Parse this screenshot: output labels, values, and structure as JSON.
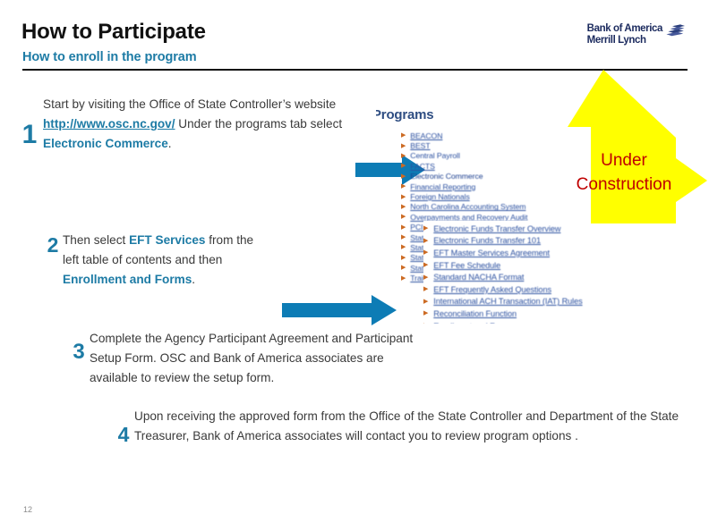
{
  "slide": {
    "title": "How to Participate",
    "subtitle": "How to enroll in the program",
    "page_number": "12"
  },
  "logo": {
    "line1": "Bank of America",
    "line2": "Merrill Lynch",
    "color": "#1b2a5e",
    "mark": "bofa-flag-icon"
  },
  "colors": {
    "accent_teal": "#1d7ba5",
    "arrow_teal": "#0d7cb5",
    "yellow": "#ffff00",
    "red": "#c00000",
    "link_blue": "#2b50a0",
    "body_gray": "#3a3a3a"
  },
  "steps": [
    {
      "number": "1",
      "text_parts": [
        {
          "t": "Start by visiting the Office of State Controller’s website ",
          "style": "plain"
        },
        {
          "t": "http://www.osc.nc.gov/",
          "style": "link"
        },
        {
          "t": " Under the  programs tab  select  ",
          "style": "plain"
        },
        {
          "t": "Electronic Commerce",
          "style": "emphasis"
        },
        {
          "t": ".",
          "style": "plain"
        }
      ]
    },
    {
      "number": "2",
      "text_parts": [
        {
          "t": "Then select ",
          "style": "plain"
        },
        {
          "t": "EFT Services",
          "style": "emphasis"
        },
        {
          "t": "  from the left table of contents and then ",
          "style": "plain"
        },
        {
          "t": "Enrollment and Forms",
          "style": "emphasis"
        },
        {
          "t": ".",
          "style": "plain"
        }
      ]
    },
    {
      "number": "3",
      "text_parts": [
        {
          "t": "Complete the Agency Participant Agreement and Participant Setup Form. OSC and Bank of America associates are available to review the setup form.",
          "style": "plain"
        }
      ]
    },
    {
      "number": "4",
      "text_parts": [
        {
          "t": "Upon receiving the approved form from the Office of the State Controller and Department of the State Treasurer, Bank of America associates will contact you to review program options .",
          "style": "plain"
        }
      ]
    }
  ],
  "screenshot": {
    "heading": "Programs",
    "programs": [
      {
        "label": "BEACON",
        "kind": "link"
      },
      {
        "label": "BEST",
        "kind": "link"
      },
      {
        "label": "Central Payroll",
        "kind": "plain"
      },
      {
        "label": "FACTS",
        "kind": "link"
      },
      {
        "label": "Electronic Commerce",
        "kind": "highlight"
      },
      {
        "label": "Financial Reporting",
        "kind": "link"
      },
      {
        "label": "Foreign Nationals",
        "kind": "link"
      },
      {
        "label": "North Carolina Accounting System",
        "kind": "link"
      },
      {
        "label": "Overpayments and Recovery Audit",
        "kind": "link"
      },
      {
        "label": "PCI Data Security",
        "kind": "link"
      },
      {
        "label": "State Cash Management Plan",
        "kind": "link"
      },
      {
        "label": "State",
        "kind": "link"
      },
      {
        "label": "State",
        "kind": "link"
      },
      {
        "label": "State",
        "kind": "link"
      },
      {
        "label": "Traini",
        "kind": "link"
      }
    ],
    "eft_submenu": [
      "Electronic Funds Transfer Overview",
      "Electronic Funds Transfer 101",
      "EFT Master Services Agreement",
      "EFT Fee Schedule",
      "Standard NACHA Format",
      "EFT Frequently Asked Questions",
      "International ACH Transaction (IAT) Rules",
      "Reconciliation Function",
      "Enrollment and Forms"
    ]
  },
  "callout": {
    "line1": "Under",
    "line2": "Construction",
    "shape": "bent-up-right-arrow"
  }
}
